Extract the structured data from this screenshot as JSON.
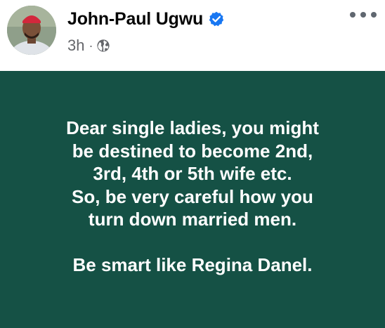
{
  "post": {
    "author_name": "John-Paul Ugwu",
    "time": "3h",
    "separator": "·",
    "verified": true,
    "audience_icon": "globe-icon",
    "more_icon": "more-horizontal-icon",
    "body_lines": [
      "Dear single ladies, you might",
      "be destined to become 2nd,",
      "3rd, 4th or 5th wife etc.",
      "So, be very careful how you",
      "turn down married men."
    ],
    "closing_line": "Be smart like Regina Danel."
  },
  "colors": {
    "background": "#155145",
    "text": "#ffffff",
    "author_text": "#050505",
    "meta_text": "#65676b",
    "verified_badge": "#1877f2"
  }
}
